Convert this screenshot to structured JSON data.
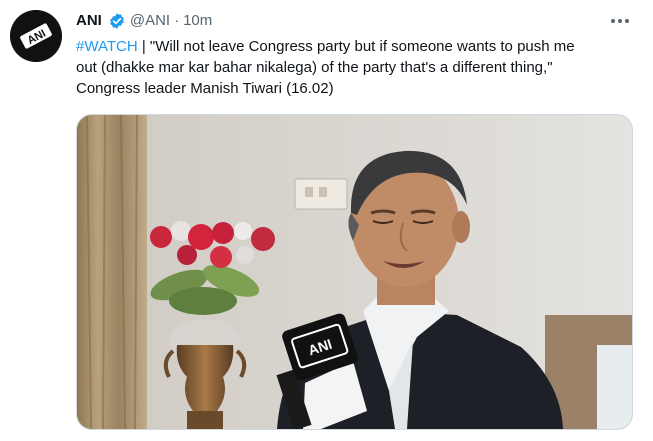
{
  "author": {
    "name": "ANI",
    "handle": "@ANI",
    "separator": "·",
    "time": "10m",
    "avatar_label": "ANI"
  },
  "tweet": {
    "hashtag": "#WATCH",
    "body_line1": " | \"Will not leave Congress party but if someone wants to push me",
    "body_line2": "out (dhakke mar kar bahar nikalega) of the party that's a different thing,\"",
    "body_line3": "Congress leader Manish Tiwari (16.02)"
  },
  "media": {
    "mic_logo": "ANI"
  },
  "icons": {
    "verified": "verified-badge-icon",
    "more": "more-options-icon"
  },
  "colors": {
    "accent": "#1d9bf0",
    "text": "#0f1419",
    "secondary": "#536471"
  }
}
